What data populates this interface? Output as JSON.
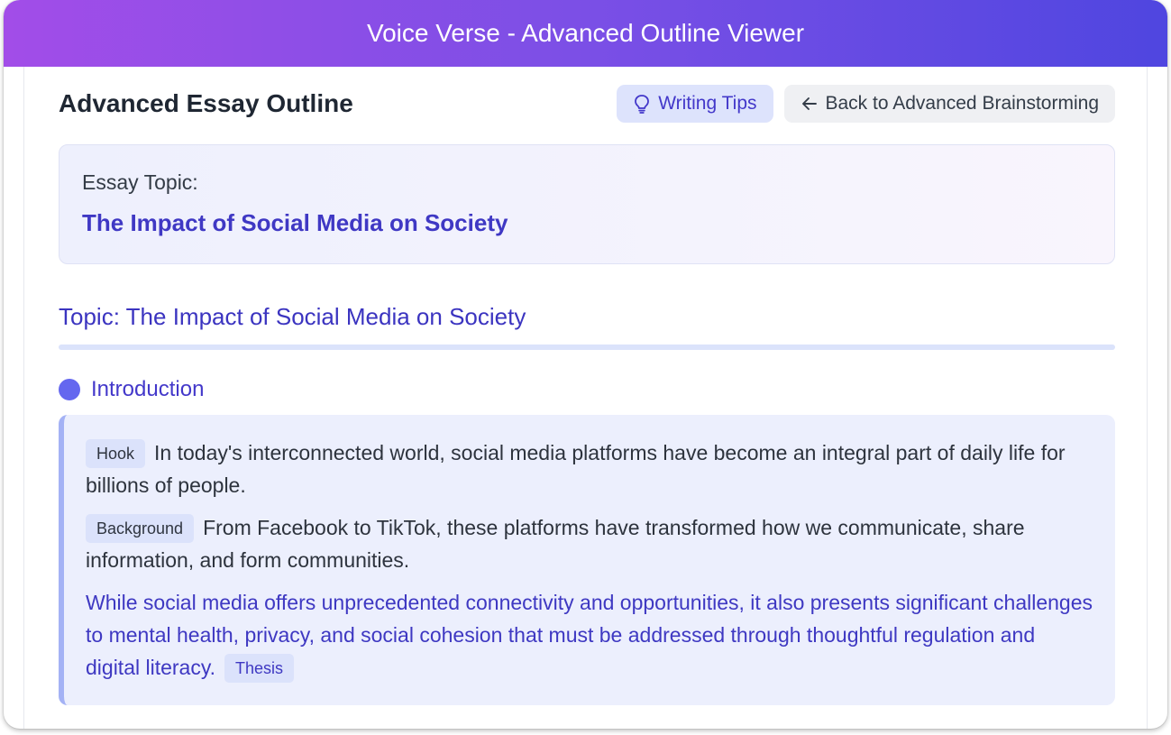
{
  "window": {
    "title": "Voice Verse - Advanced Outline Viewer"
  },
  "header": {
    "title": "Advanced Essay Outline",
    "tips_label": "Writing Tips",
    "back_label": "Back to Advanced Brainstorming"
  },
  "topic_card": {
    "label": "Essay Topic:",
    "value": "The Impact of Social Media on Society"
  },
  "outline": {
    "topic": "Topic: The Impact of Social Media on Society",
    "section": {
      "title": "Introduction",
      "hook": {
        "tag": "Hook",
        "text": "In today's interconnected world, social media platforms have become an integral part of daily life for billions of people."
      },
      "background": {
        "tag": "Background",
        "text": "From Facebook to TikTok, these platforms have transformed how we communicate, share information, and form communities."
      },
      "thesis": {
        "tag": "Thesis",
        "text": "While social media offers unprecedented connectivity and opportunities, it also presents significant challenges to mental health, privacy, and social cohesion that must be addressed through thoughtful regulation and digital literacy."
      }
    }
  },
  "icons": {
    "tips": "lightbulb-icon",
    "back": "arrow-left-icon",
    "section": "dot-icon"
  },
  "colors": {
    "accent": "#4338ca",
    "title_gradient_start": "#a24de8",
    "title_gradient_end": "#4f46e0"
  }
}
